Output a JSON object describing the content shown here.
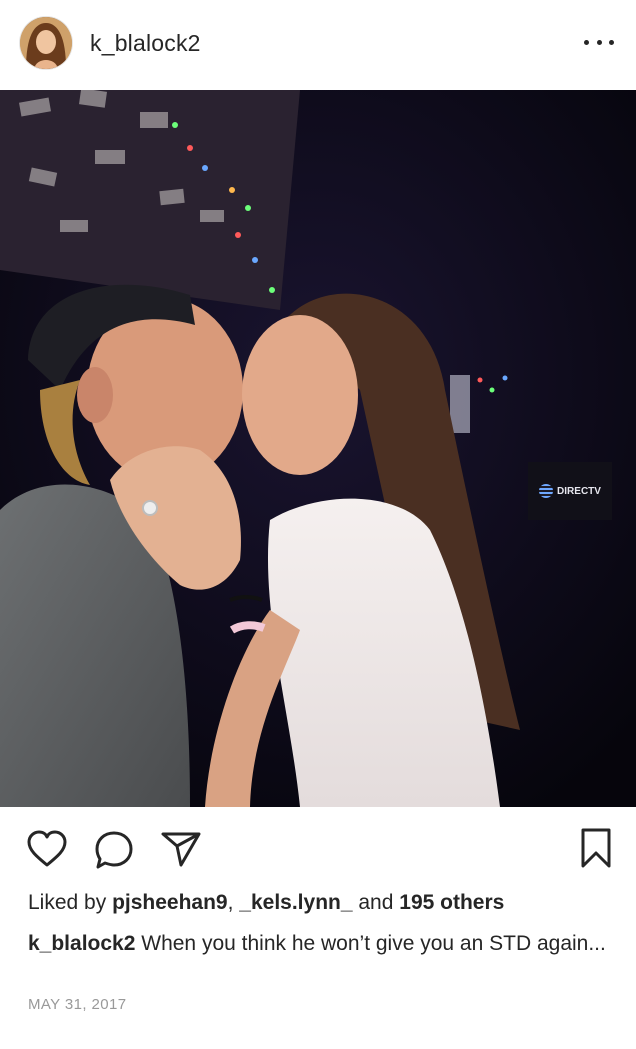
{
  "post": {
    "username": "k_blalock2",
    "more_icon": "more-horizontal-icon",
    "photo_alt": "",
    "photo_sign": "DIRECTV"
  },
  "actions": {
    "like_icon": "heart-icon",
    "comment_icon": "comment-icon",
    "share_icon": "share-icon",
    "save_icon": "bookmark-icon"
  },
  "likes": {
    "prefix": "Liked by",
    "user1": "pjsheehan9",
    "separator": ",",
    "user2": "_kels.lynn_",
    "conjunction": "and",
    "others": "195 others"
  },
  "caption": {
    "username": "k_blalock2",
    "text": "When you think he won’t give you an STD again..."
  },
  "date": "MAY 31, 2017"
}
